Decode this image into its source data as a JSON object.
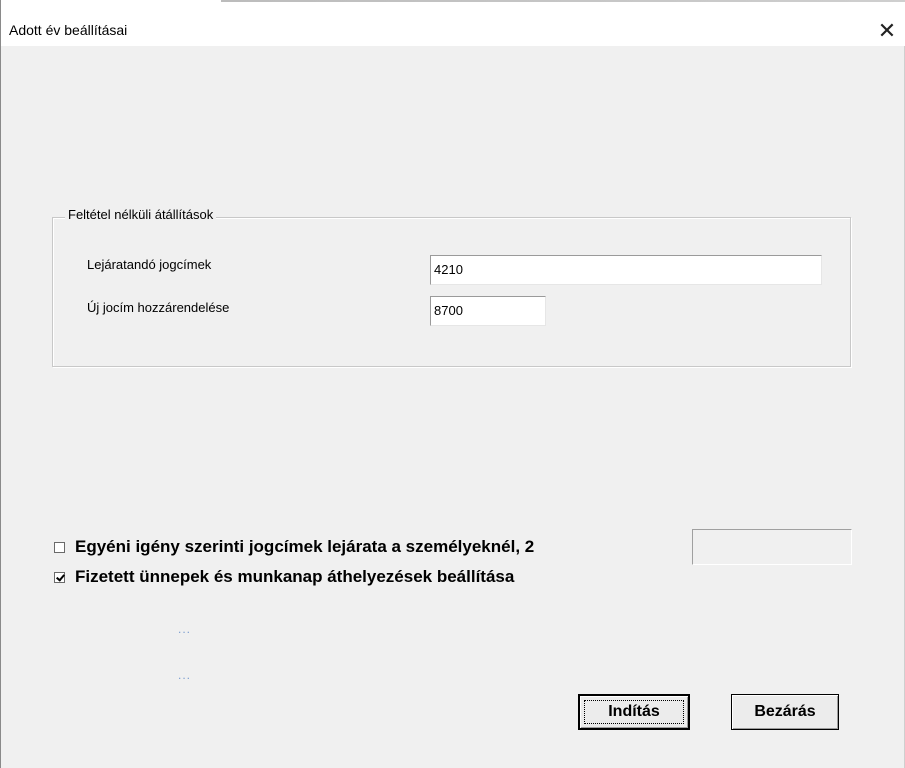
{
  "window": {
    "title": "Adott év beállításai",
    "close_icon": "close-icon",
    "close_glyph": "✕"
  },
  "group": {
    "legend": "Feltétel nélküli átállítások",
    "fields": [
      {
        "label": "Lejáratandó jogcímek",
        "value": "4210"
      },
      {
        "label": "Új jocím hozzárendelése",
        "value": "8700"
      }
    ]
  },
  "options": {
    "individual_expiry": {
      "label": "Egyéni igény szerinti jogcímek lejárata a személyeknél, 2",
      "checked": false
    },
    "paid_holidays": {
      "label": "Fizetett ünnepek és munkanap áthelyezések beállítása",
      "checked": true
    }
  },
  "status": {
    "line1": "...",
    "line2": "..."
  },
  "buttons": {
    "start": "Indítás",
    "close": "Bezárás"
  }
}
